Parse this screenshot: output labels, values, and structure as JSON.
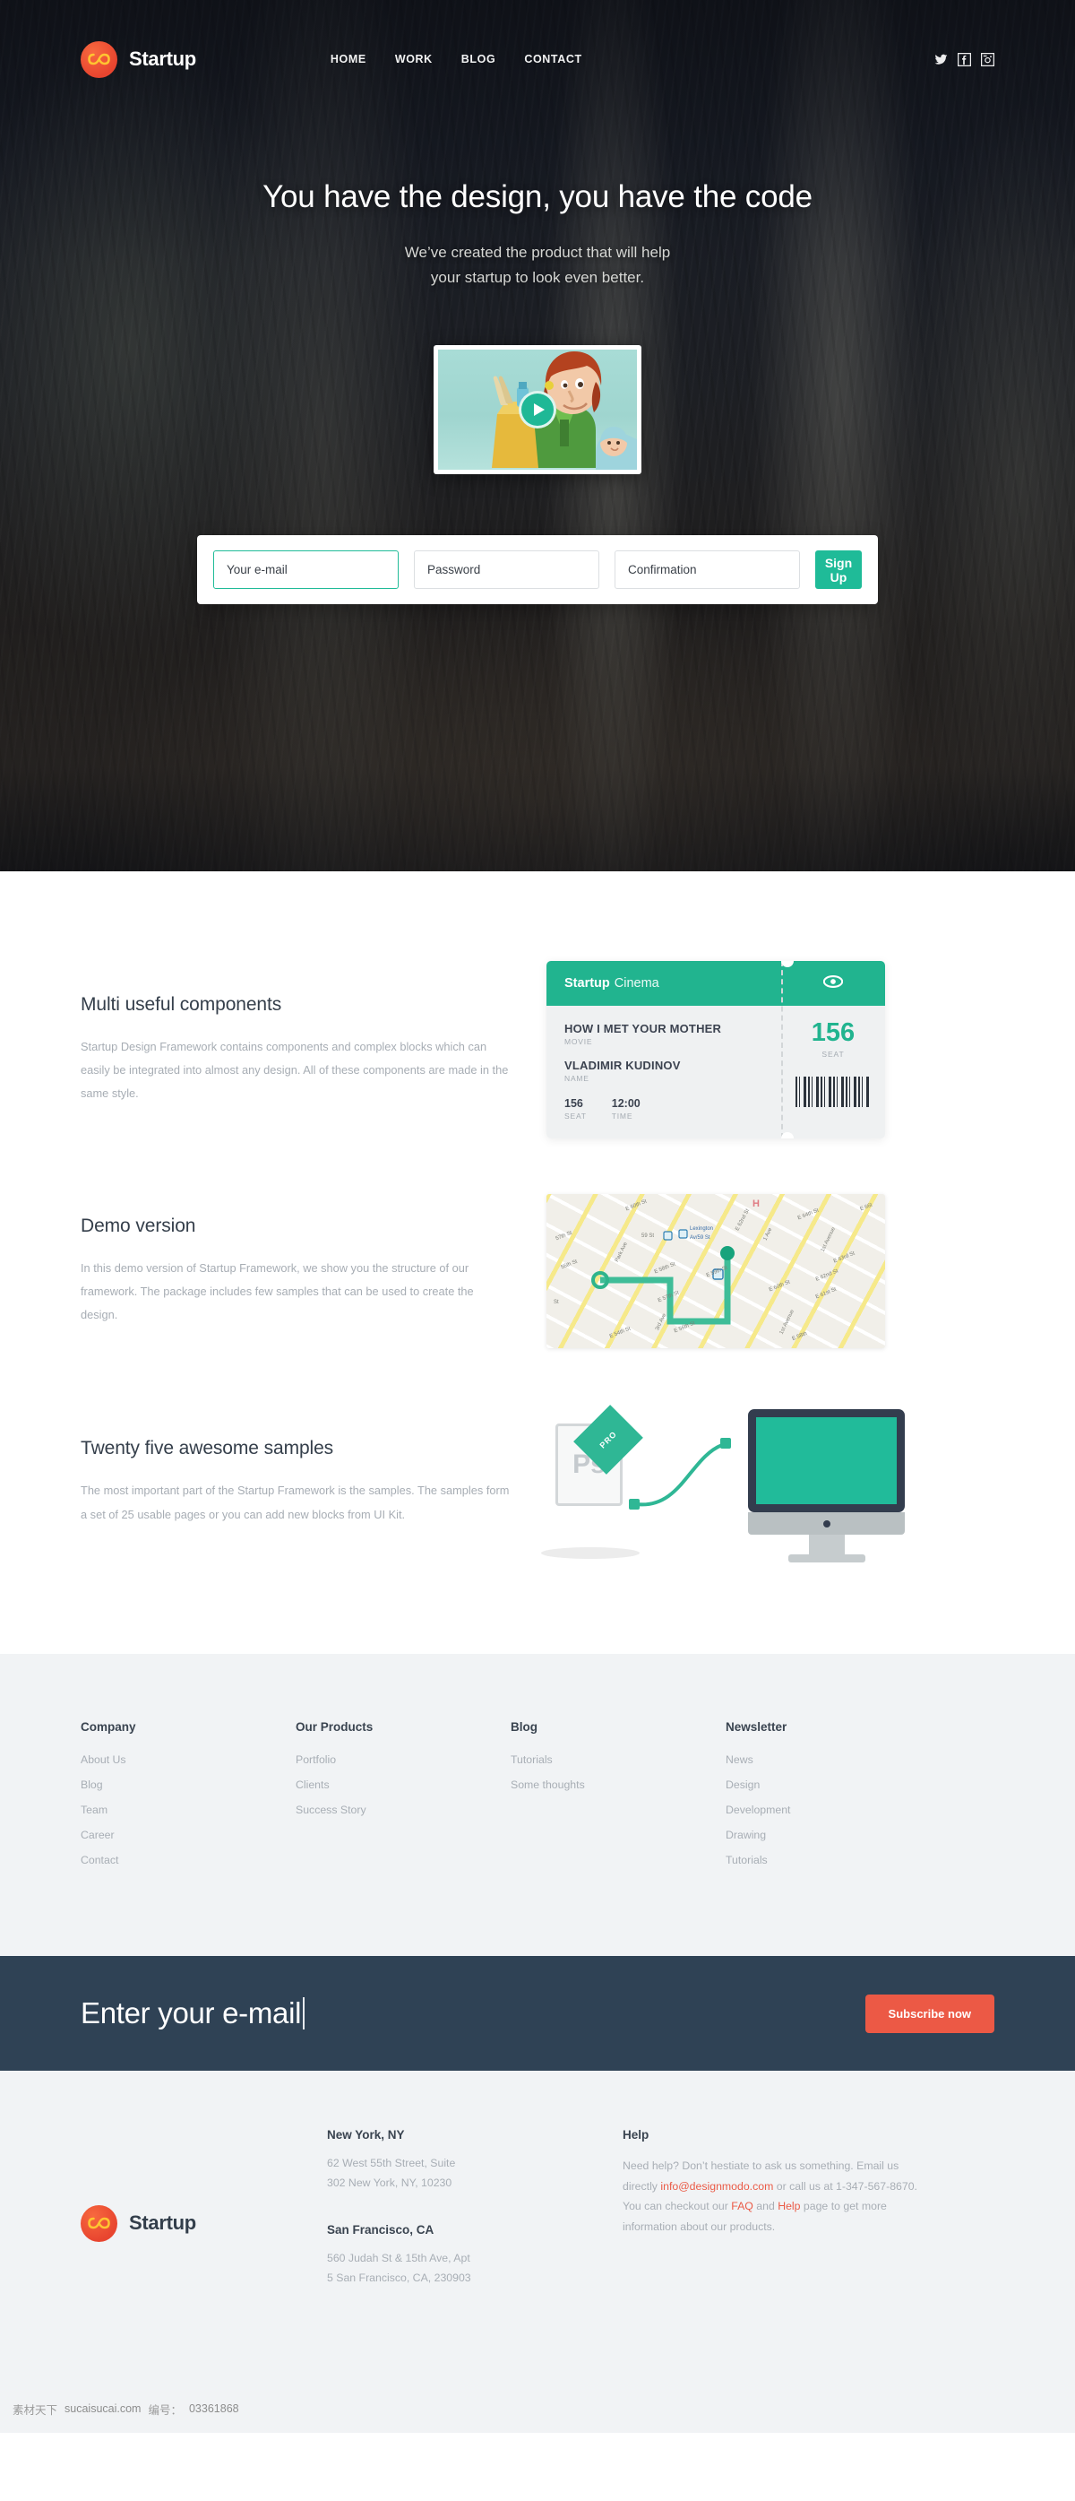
{
  "header": {
    "brand": "Startup",
    "nav": [
      {
        "label": "HOME"
      },
      {
        "label": "WORK"
      },
      {
        "label": "BLOG"
      },
      {
        "label": "CONTACT"
      }
    ],
    "socials": [
      {
        "name": "twitter-icon"
      },
      {
        "name": "facebook-icon"
      },
      {
        "name": "instagram-icon"
      }
    ]
  },
  "hero": {
    "title": "You have the design, you have the code",
    "subtitle_line1": "We’ve created the product that will help",
    "subtitle_line2": "your startup to look even better.",
    "video_play_label": "play-video"
  },
  "signup": {
    "email_placeholder": "Your e-mail",
    "password_placeholder": "Password",
    "confirmation_placeholder": "Confirmation",
    "button_label": "Sign Up"
  },
  "features": [
    {
      "title": "Multi useful components",
      "body": "Startup Design Framework contains components and complex blocks which can easily be integrated into almost any design. All of these components are made in the same style.",
      "art": "cinema-ticket"
    },
    {
      "title": "Demo version",
      "body": "In this demo version of Startup Framework, we show you the structure of our framework. The package includes few samples that can be used to create the design.",
      "art": "map"
    },
    {
      "title": "Twenty five awesome samples",
      "body": "The most important part of the Startup Framework is the samples. The samples form a set of 25 usable pages or you can add new blocks from UI Kit.",
      "art": "photoshop-monitor"
    }
  ],
  "ticket": {
    "brand_bold": "Startup",
    "brand_light": "Cinema",
    "movie_title": "HOW I MET YOUR MOTHER",
    "movie_label": "MOVIE",
    "name_value": "VLADIMIR KUDINOV",
    "name_label": "NAME",
    "seat_value": "156",
    "seat_label": "SEAT",
    "time_value": "12:00",
    "time_label": "TIME",
    "stub_seat_value": "156",
    "stub_seat_label": "SEAT"
  },
  "map": {
    "labels": [
      "E 60th St",
      "E 62nd St",
      "E 64th St",
      "E 66th",
      "57th St",
      "Park Ave",
      "E 58th St",
      "E 59th St",
      "E 63rd St",
      "56th St",
      "E 57th St",
      "E 60th St",
      "E 61st St",
      "E 62nd St",
      "E 54th St",
      "3rd Ave",
      "E 56th St",
      "E 58th",
      "1st Avenue",
      "59 St",
      "Lexington",
      "Av/59 St",
      "1 Ave",
      "1st Avenue",
      "H",
      "St"
    ]
  },
  "ps_art": {
    "file_label": "Ps",
    "ribbon_label": "PRO"
  },
  "footer_links": [
    {
      "heading": "Company",
      "items": [
        "About Us",
        "Blog",
        "Team",
        "Career",
        "Contact"
      ]
    },
    {
      "heading": "Our Products",
      "items": [
        "Portfolio",
        "Clients",
        "Success Story"
      ]
    },
    {
      "heading": "Blog",
      "items": [
        "Tutorials",
        "Some thoughts"
      ]
    },
    {
      "heading": "Newsletter",
      "items": [
        "News",
        "Design",
        "Development",
        "Drawing",
        "Tutorials"
      ]
    }
  ],
  "newsletter": {
    "input_value": "Enter your e-mail",
    "button_label": "Subscribe now"
  },
  "bottom_footer": {
    "brand": "Startup",
    "offices": [
      {
        "city": "New York, NY",
        "address": "62 West 55th Street, Suite\n302 New York, NY, 10230"
      },
      {
        "city": "San Francisco, CA",
        "address": "560 Judah St & 15th Ave, Apt\n5 San Francisco, CA, 230903"
      }
    ],
    "help": {
      "heading": "Help",
      "text_1": "Need help? Don’t hestiate to ask us something. Email us directly ",
      "link_email": "info@designmodo.com",
      "text_2": " or call us at 1-347-567-8670. You can checkout our ",
      "link_faq": "FAQ",
      "text_3": " and ",
      "link_help": "Help",
      "text_4": " page to get more information about our products."
    }
  },
  "watermark": {
    "site_cn": "素材天下",
    "site": "sucaisucai.com",
    "id_label": "编号：",
    "id_value": "03361868"
  },
  "colors": {
    "accent_green": "#21b48f",
    "accent_red": "#ec5945",
    "dark_navy": "#2f4255",
    "light_gray": "#f1f3f5",
    "heading": "#3a4450",
    "muted_text": "#a8aeb5"
  }
}
